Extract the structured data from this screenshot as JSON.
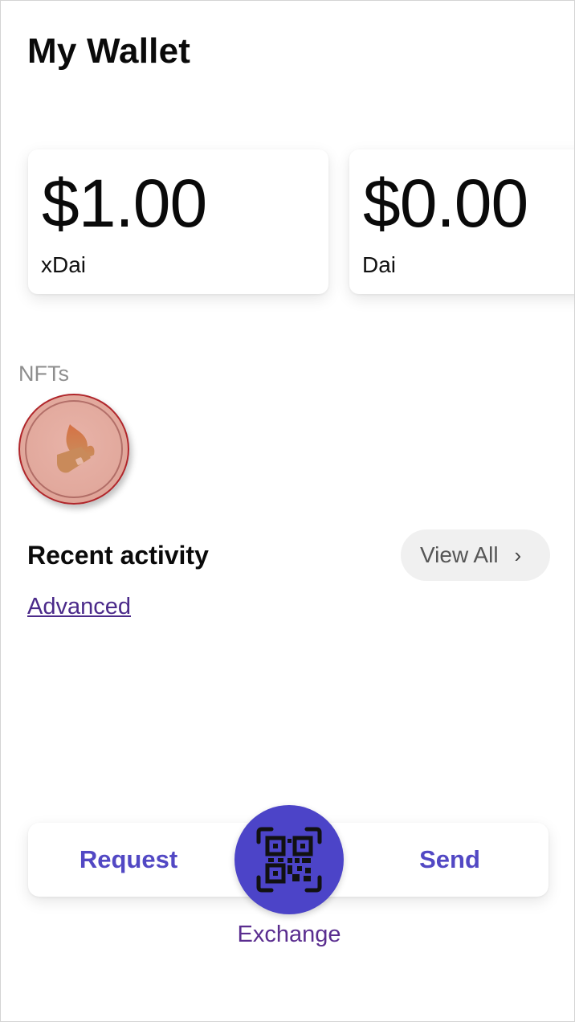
{
  "header": {
    "title": "My Wallet"
  },
  "balances": [
    {
      "amount": "$1.00",
      "token": "xDai"
    },
    {
      "amount": "$0.00",
      "token": "Dai"
    }
  ],
  "nfts": {
    "label": "NFTs",
    "items": [
      {
        "icon": "flame-wallet-icon",
        "color": "#e2a99d",
        "border_color": "#b0262b"
      }
    ]
  },
  "recent_activity": {
    "title": "Recent activity",
    "view_all_label": "View All",
    "view_all_icon": "chevron-right-icon"
  },
  "advanced_link": "Advanced",
  "actions": {
    "request_label": "Request",
    "send_label": "Send",
    "exchange_label": "Exchange",
    "scan_icon": "qr-scan-icon",
    "accent_color": "#4c44c8"
  }
}
